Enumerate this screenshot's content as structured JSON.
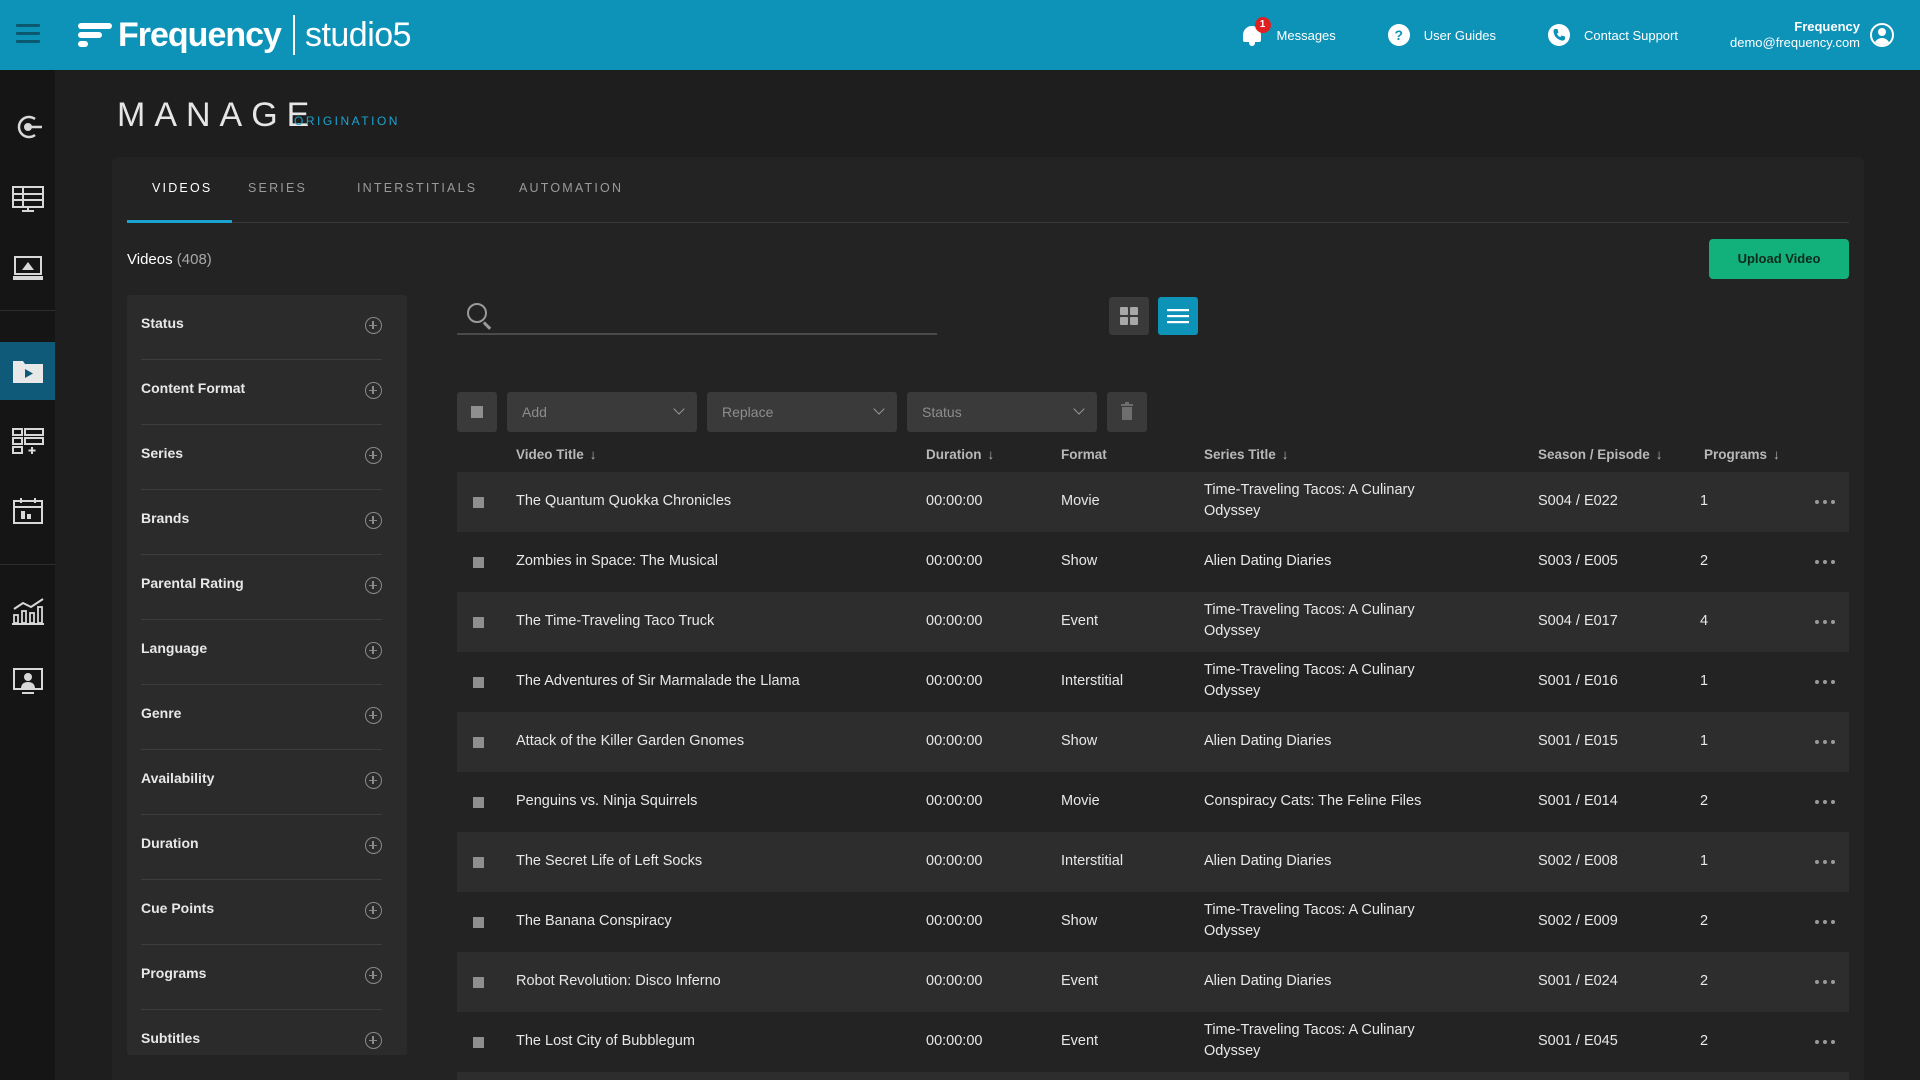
{
  "header": {
    "brand": "Frequency",
    "product": "studio5",
    "messages_label": "Messages",
    "messages_badge": "1",
    "guides_label": "User Guides",
    "support_label": "Contact Support",
    "user_name": "Frequency",
    "user_email": "demo@frequency.com"
  },
  "page": {
    "title": "MANAGE",
    "subtitle": "ORIGINATION"
  },
  "tabs": [
    {
      "label": "VIDEOS",
      "active": true
    },
    {
      "label": "SERIES",
      "active": false
    },
    {
      "label": "INTERSTITIALS",
      "active": false
    },
    {
      "label": "AUTOMATION",
      "active": false
    }
  ],
  "content": {
    "heading": "Videos",
    "count": "(408)",
    "upload_label": "Upload Video",
    "search_placeholder": ""
  },
  "filters": [
    "Status",
    "Content Format",
    "Series",
    "Brands",
    "Parental Rating",
    "Language",
    "Genre",
    "Availability",
    "Duration",
    "Cue Points",
    "Programs",
    "Subtitles"
  ],
  "bulk": {
    "add": "Add",
    "replace": "Replace",
    "status": "Status"
  },
  "columns": {
    "title": "Video Title",
    "duration": "Duration",
    "format": "Format",
    "series": "Series Title",
    "season": "Season / Episode",
    "programs": "Programs",
    "sort_arrow": "↓"
  },
  "rows": [
    {
      "title": "The Quantum Quokka Chronicles",
      "duration": "00:00:00",
      "format": "Movie",
      "series_line1": "Time-Traveling Tacos: A Culinary",
      "series_line2": "Odyssey",
      "season": "S004 / E022",
      "programs": "1"
    },
    {
      "title": "Zombies in Space: The Musical",
      "duration": "00:00:00",
      "format": "Show",
      "series_line1": "Alien Dating Diaries",
      "series_line2": "",
      "season": "S003 / E005",
      "programs": "2"
    },
    {
      "title": "The Time-Traveling Taco Truck",
      "duration": "00:00:00",
      "format": "Event",
      "series_line1": "Time-Traveling Tacos: A Culinary",
      "series_line2": "Odyssey",
      "season": "S004 / E017",
      "programs": "4"
    },
    {
      "title": "The Adventures of Sir Marmalade the Llama",
      "duration": "00:00:00",
      "format": "Interstitial",
      "series_line1": "Time-Traveling Tacos: A Culinary",
      "series_line2": "Odyssey",
      "season": "S001 / E016",
      "programs": "1"
    },
    {
      "title": "Attack of the Killer Garden Gnomes",
      "duration": "00:00:00",
      "format": "Show",
      "series_line1": "Alien Dating Diaries",
      "series_line2": "",
      "season": "S001 / E015",
      "programs": "1"
    },
    {
      "title": "Penguins vs. Ninja Squirrels",
      "duration": "00:00:00",
      "format": "Movie",
      "series_line1": "Conspiracy Cats: The Feline Files",
      "series_line2": "",
      "season": "S001 / E014",
      "programs": "2"
    },
    {
      "title": "The Secret Life of Left Socks",
      "duration": "00:00:00",
      "format": "Interstitial",
      "series_line1": "Alien Dating Diaries",
      "series_line2": "",
      "season": "S002 / E008",
      "programs": "1"
    },
    {
      "title": "The Banana Conspiracy",
      "duration": "00:00:00",
      "format": "Show",
      "series_line1": "Time-Traveling Tacos: A Culinary",
      "series_line2": "Odyssey",
      "season": "S002 / E009",
      "programs": "2"
    },
    {
      "title": "Robot Revolution: Disco Inferno",
      "duration": "00:00:00",
      "format": "Event",
      "series_line1": "Alien Dating Diaries",
      "series_line2": "",
      "season": "S001 / E024",
      "programs": "2"
    },
    {
      "title": "The Lost City of Bubblegum",
      "duration": "00:00:00",
      "format": "Event",
      "series_line1": "Time-Traveling Tacos: A Culinary",
      "series_line2": "Odyssey",
      "season": "S001 / E045",
      "programs": "2"
    }
  ],
  "colors": {
    "header": "#0e93b8",
    "accent": "#1ba3cf",
    "upload": "#12b07a",
    "nav_active": "#0f5a78"
  },
  "nav_icons": [
    "origination-icon",
    "schedule-grid-icon",
    "monitor-icon",
    "video-library-icon",
    "layout-add-icon",
    "calendar-icon",
    "analytics-icon",
    "user-settings-icon"
  ]
}
